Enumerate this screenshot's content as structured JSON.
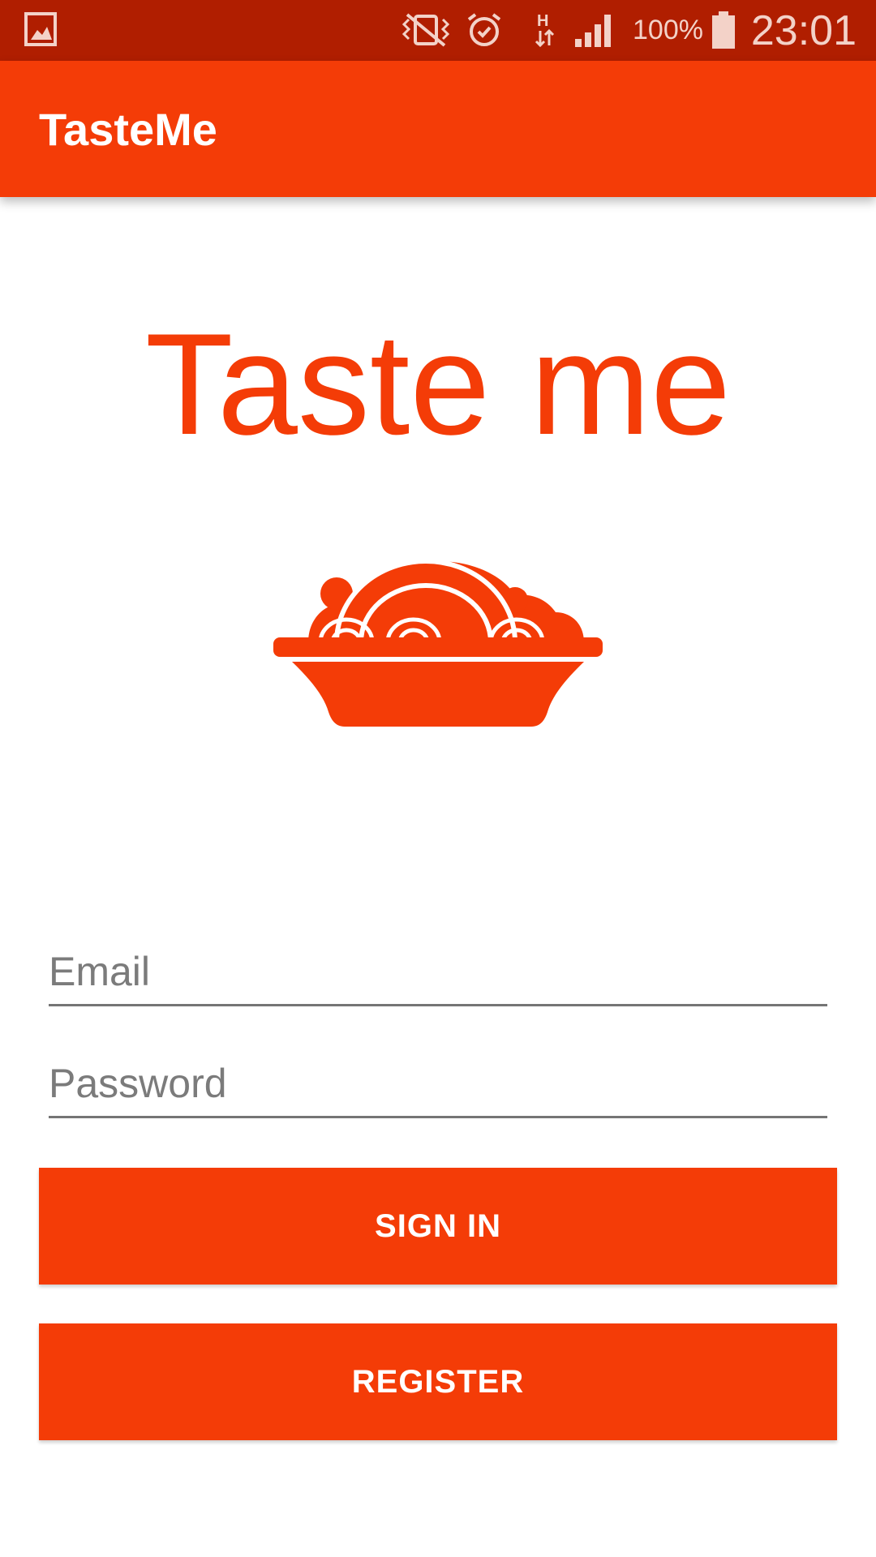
{
  "status_bar": {
    "icons": [
      "gallery-notification-icon",
      "vibrate-icon",
      "alarm-icon",
      "h-data-icon",
      "signal-icon",
      "battery-icon"
    ],
    "battery_percent": "100%",
    "time": "23:01",
    "color": "#b01e00"
  },
  "app_bar": {
    "title": "TasteMe",
    "color": "#f43c07"
  },
  "hero": {
    "title": "Taste me",
    "logo_icon": "spaghetti-bowl-icon"
  },
  "form": {
    "email": {
      "placeholder": "Email",
      "value": ""
    },
    "password": {
      "placeholder": "Password",
      "value": ""
    },
    "sign_in_label": "SIGN IN",
    "register_label": "REGISTER"
  },
  "colors": {
    "accent": "#f43c07",
    "status_bar": "#b01e00",
    "background": "#ffffff"
  }
}
